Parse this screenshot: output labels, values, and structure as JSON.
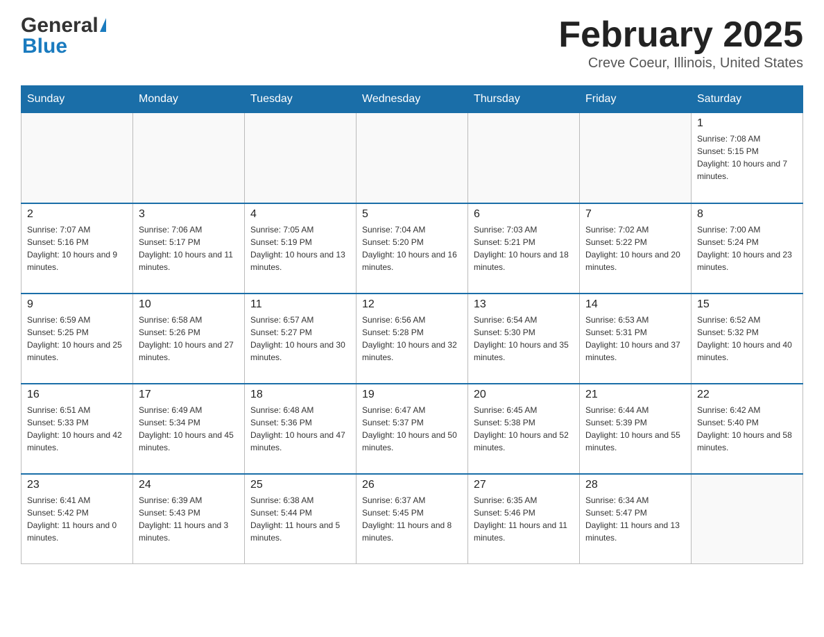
{
  "header": {
    "logo_general": "General",
    "logo_blue": "Blue",
    "month_title": "February 2025",
    "location": "Creve Coeur, Illinois, United States"
  },
  "days_of_week": [
    "Sunday",
    "Monday",
    "Tuesday",
    "Wednesday",
    "Thursday",
    "Friday",
    "Saturday"
  ],
  "weeks": [
    [
      {
        "day": "",
        "info": ""
      },
      {
        "day": "",
        "info": ""
      },
      {
        "day": "",
        "info": ""
      },
      {
        "day": "",
        "info": ""
      },
      {
        "day": "",
        "info": ""
      },
      {
        "day": "",
        "info": ""
      },
      {
        "day": "1",
        "info": "Sunrise: 7:08 AM\nSunset: 5:15 PM\nDaylight: 10 hours and 7 minutes."
      }
    ],
    [
      {
        "day": "2",
        "info": "Sunrise: 7:07 AM\nSunset: 5:16 PM\nDaylight: 10 hours and 9 minutes."
      },
      {
        "day": "3",
        "info": "Sunrise: 7:06 AM\nSunset: 5:17 PM\nDaylight: 10 hours and 11 minutes."
      },
      {
        "day": "4",
        "info": "Sunrise: 7:05 AM\nSunset: 5:19 PM\nDaylight: 10 hours and 13 minutes."
      },
      {
        "day": "5",
        "info": "Sunrise: 7:04 AM\nSunset: 5:20 PM\nDaylight: 10 hours and 16 minutes."
      },
      {
        "day": "6",
        "info": "Sunrise: 7:03 AM\nSunset: 5:21 PM\nDaylight: 10 hours and 18 minutes."
      },
      {
        "day": "7",
        "info": "Sunrise: 7:02 AM\nSunset: 5:22 PM\nDaylight: 10 hours and 20 minutes."
      },
      {
        "day": "8",
        "info": "Sunrise: 7:00 AM\nSunset: 5:24 PM\nDaylight: 10 hours and 23 minutes."
      }
    ],
    [
      {
        "day": "9",
        "info": "Sunrise: 6:59 AM\nSunset: 5:25 PM\nDaylight: 10 hours and 25 minutes."
      },
      {
        "day": "10",
        "info": "Sunrise: 6:58 AM\nSunset: 5:26 PM\nDaylight: 10 hours and 27 minutes."
      },
      {
        "day": "11",
        "info": "Sunrise: 6:57 AM\nSunset: 5:27 PM\nDaylight: 10 hours and 30 minutes."
      },
      {
        "day": "12",
        "info": "Sunrise: 6:56 AM\nSunset: 5:28 PM\nDaylight: 10 hours and 32 minutes."
      },
      {
        "day": "13",
        "info": "Sunrise: 6:54 AM\nSunset: 5:30 PM\nDaylight: 10 hours and 35 minutes."
      },
      {
        "day": "14",
        "info": "Sunrise: 6:53 AM\nSunset: 5:31 PM\nDaylight: 10 hours and 37 minutes."
      },
      {
        "day": "15",
        "info": "Sunrise: 6:52 AM\nSunset: 5:32 PM\nDaylight: 10 hours and 40 minutes."
      }
    ],
    [
      {
        "day": "16",
        "info": "Sunrise: 6:51 AM\nSunset: 5:33 PM\nDaylight: 10 hours and 42 minutes."
      },
      {
        "day": "17",
        "info": "Sunrise: 6:49 AM\nSunset: 5:34 PM\nDaylight: 10 hours and 45 minutes."
      },
      {
        "day": "18",
        "info": "Sunrise: 6:48 AM\nSunset: 5:36 PM\nDaylight: 10 hours and 47 minutes."
      },
      {
        "day": "19",
        "info": "Sunrise: 6:47 AM\nSunset: 5:37 PM\nDaylight: 10 hours and 50 minutes."
      },
      {
        "day": "20",
        "info": "Sunrise: 6:45 AM\nSunset: 5:38 PM\nDaylight: 10 hours and 52 minutes."
      },
      {
        "day": "21",
        "info": "Sunrise: 6:44 AM\nSunset: 5:39 PM\nDaylight: 10 hours and 55 minutes."
      },
      {
        "day": "22",
        "info": "Sunrise: 6:42 AM\nSunset: 5:40 PM\nDaylight: 10 hours and 58 minutes."
      }
    ],
    [
      {
        "day": "23",
        "info": "Sunrise: 6:41 AM\nSunset: 5:42 PM\nDaylight: 11 hours and 0 minutes."
      },
      {
        "day": "24",
        "info": "Sunrise: 6:39 AM\nSunset: 5:43 PM\nDaylight: 11 hours and 3 minutes."
      },
      {
        "day": "25",
        "info": "Sunrise: 6:38 AM\nSunset: 5:44 PM\nDaylight: 11 hours and 5 minutes."
      },
      {
        "day": "26",
        "info": "Sunrise: 6:37 AM\nSunset: 5:45 PM\nDaylight: 11 hours and 8 minutes."
      },
      {
        "day": "27",
        "info": "Sunrise: 6:35 AM\nSunset: 5:46 PM\nDaylight: 11 hours and 11 minutes."
      },
      {
        "day": "28",
        "info": "Sunrise: 6:34 AM\nSunset: 5:47 PM\nDaylight: 11 hours and 13 minutes."
      },
      {
        "day": "",
        "info": ""
      }
    ]
  ]
}
